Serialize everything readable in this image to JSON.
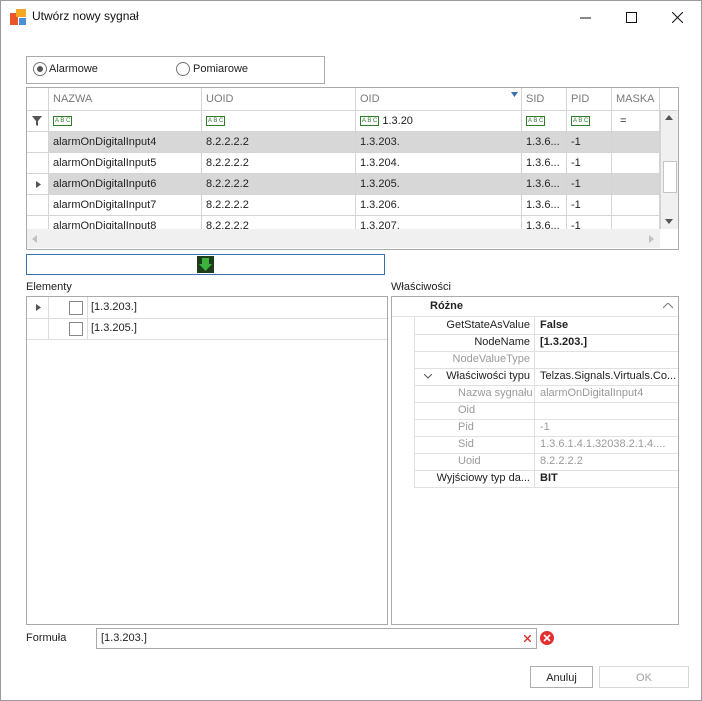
{
  "window": {
    "title": "Utwórz nowy sygnał"
  },
  "mode": {
    "options": [
      {
        "label": "Alarmowe",
        "selected": true
      },
      {
        "label": "Pomiarowe",
        "selected": false
      }
    ]
  },
  "grid": {
    "columns": [
      "NAZWA",
      "UOID",
      "OID",
      "SID",
      "PID",
      "MASKA"
    ],
    "filter": {
      "oid": "1.3.20",
      "maska": "="
    },
    "rows": [
      {
        "nazwa": "alarmOnDigitalInput4",
        "uoid": "8.2.2.2.2",
        "oid": "1.3.203.",
        "sid": "1.3.6...",
        "pid": "-1",
        "selected": true
      },
      {
        "nazwa": "alarmOnDigitalInput5",
        "uoid": "8.2.2.2.2",
        "oid": "1.3.204.",
        "sid": "1.3.6...",
        "pid": "-1",
        "selected": false
      },
      {
        "nazwa": "alarmOnDigitalInput6",
        "uoid": "8.2.2.2.2",
        "oid": "1.3.205.",
        "sid": "1.3.6...",
        "pid": "-1",
        "selected": true
      },
      {
        "nazwa": "alarmOnDigitalInput7",
        "uoid": "8.2.2.2.2",
        "oid": "1.3.206.",
        "sid": "1.3.6...",
        "pid": "-1",
        "selected": false
      },
      {
        "nazwa": "alarmOnDigitalInput8",
        "uoid": "8.2.2.2.2",
        "oid": "1.3.207.",
        "sid": "1.3.6...",
        "pid": "-1",
        "selected": false
      }
    ]
  },
  "elements": {
    "label": "Elementy",
    "items": [
      "[1.3.203.]",
      "[1.3.205.]"
    ]
  },
  "properties": {
    "label": "Właściwości",
    "category": "Różne",
    "rows": [
      {
        "name": "GetStateAsValue",
        "value": "False"
      },
      {
        "name": "NodeName",
        "value": "[1.3.203.]"
      },
      {
        "name": "NodeValueType",
        "value": ""
      },
      {
        "name": "Właściwości typu",
        "value": "Telzas.Signals.Virtuals.Co..."
      },
      {
        "name": "Nazwa sygnału",
        "value": "alarmOnDigitalInput4"
      },
      {
        "name": "Oid",
        "value": ""
      },
      {
        "name": "Pid",
        "value": "-1"
      },
      {
        "name": "Sid",
        "value": "1.3.6.1.4.1.32038.2.1.4...."
      },
      {
        "name": "Uoid",
        "value": "8.2.2.2.2"
      },
      {
        "name": "Wyjściowy typ da...",
        "value": "BIT"
      }
    ]
  },
  "formula": {
    "label": "Formuła",
    "value": "[1.3.203.]"
  },
  "buttons": {
    "cancel": "Anuluj",
    "ok": "OK"
  },
  "colors": {
    "selected_row": "#d7d7d7",
    "arrow": "#3cb43c",
    "error": "#e03030",
    "splitter_border": "#3c6fb0"
  }
}
